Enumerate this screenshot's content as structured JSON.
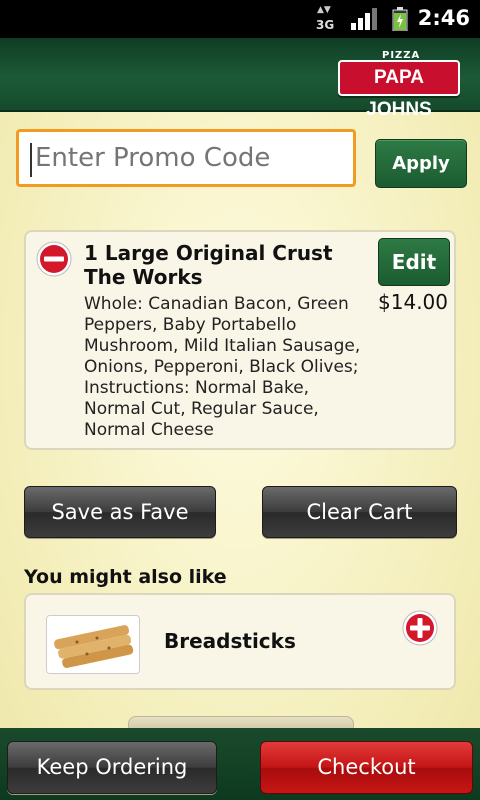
{
  "status_bar": {
    "time": "2:46",
    "network": "3G"
  },
  "header": {
    "logo_small": "PIZZA",
    "logo_text": "PAPA JOHNS"
  },
  "promo": {
    "placeholder": "Enter Promo Code",
    "value": "",
    "apply_label": "Apply"
  },
  "cart_item": {
    "title": "1 Large Original Crust The Works",
    "description": "Whole: Canadian Bacon, Green Peppers, Baby Portabello Mushroom, Mild Italian Sausage, Onions, Pepperoni, Black Olives; Instructions: Normal Bake, Normal Cut, Regular Sauce, Normal Cheese",
    "edit_label": "Edit",
    "price": "$14.00"
  },
  "actions": {
    "save_label": "Save as Fave",
    "clear_label": "Clear Cart"
  },
  "suggestions": {
    "heading": "You might also like",
    "items": [
      {
        "name": "Breadsticks"
      }
    ]
  },
  "footer": {
    "keep_label": "Keep Ordering",
    "checkout_label": "Checkout"
  },
  "colors": {
    "brand_green": "#1d5a36",
    "brand_red": "#c8102e",
    "accent_orange": "#f29b22"
  }
}
